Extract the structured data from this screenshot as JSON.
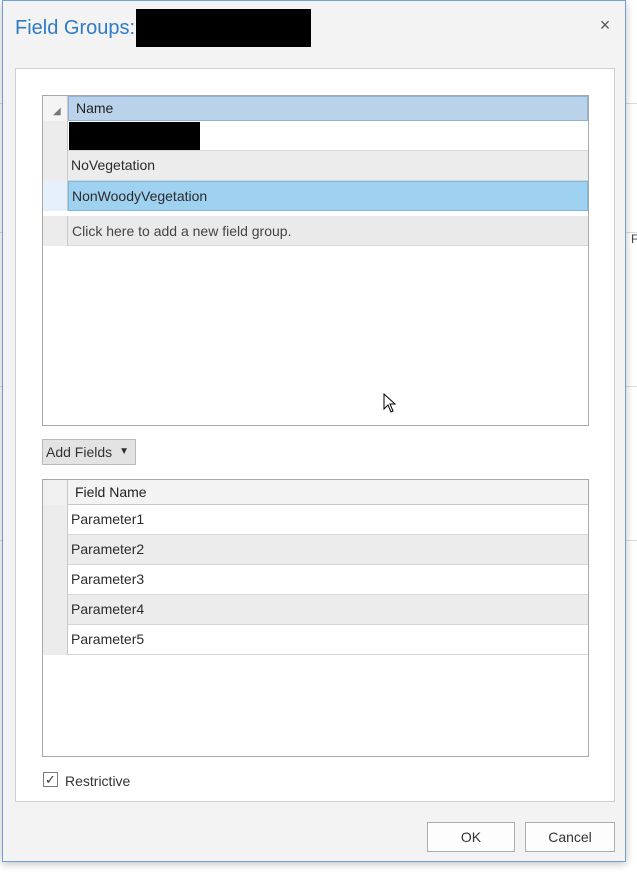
{
  "dialog": {
    "title": "Field Groups:",
    "close_glyph": "×"
  },
  "groups_table": {
    "column_header": "Name",
    "rows": [
      {
        "label": ""
      },
      {
        "label": "NoVegetation"
      },
      {
        "label": "NonWoodyVegetation"
      }
    ],
    "add_row_text": "Click here to add a new field group."
  },
  "add_fields_button": {
    "label": "Add Fields",
    "arrow": "▼"
  },
  "fields_table": {
    "column_header": "Field Name",
    "rows": [
      {
        "label": "Parameter1"
      },
      {
        "label": "Parameter2"
      },
      {
        "label": "Parameter3"
      },
      {
        "label": "Parameter4"
      },
      {
        "label": "Parameter5"
      }
    ]
  },
  "restrictive": {
    "label": "Restrictive",
    "checked_glyph": "✓"
  },
  "buttons": {
    "ok": "OK",
    "cancel": "Cancel"
  },
  "background_fragments": {
    "right_letter": "F"
  }
}
